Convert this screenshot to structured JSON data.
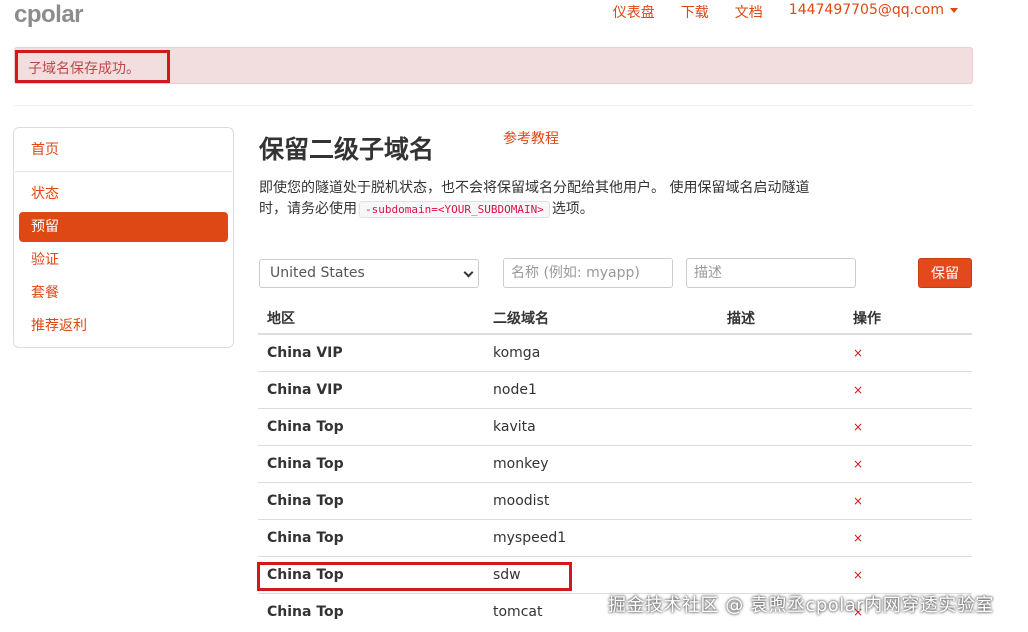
{
  "header": {
    "logo": "cpolar",
    "nav": [
      "仪表盘",
      "下载",
      "文档"
    ],
    "user_email": "1447497705@qq.com"
  },
  "alert": {
    "message": "子域名保存成功。"
  },
  "sidebar": {
    "items": [
      {
        "label": "首页",
        "active": false
      },
      {
        "label": "状态",
        "active": false
      },
      {
        "label": "预留",
        "active": true
      },
      {
        "label": "验证",
        "active": false
      },
      {
        "label": "套餐",
        "active": false
      },
      {
        "label": "推荐返利",
        "active": false
      }
    ]
  },
  "main": {
    "title": "保留二级子域名",
    "ref_link": "参考教程",
    "desc_part1": "即使您的隧道处于脱机状态，也不会将保留域名分配给其他用户。 使用保留域名启动隧道时，请务必使用",
    "desc_code": "-subdomain=<YOUR_SUBDOMAIN>",
    "desc_part2": "选项。"
  },
  "form": {
    "region_selected": "United States",
    "name_placeholder": "名称 (例如: myapp)",
    "desc_placeholder": "描述",
    "save_label": "保留"
  },
  "table": {
    "headers": [
      "地区",
      "二级域名",
      "描述",
      "操作"
    ],
    "delete_glyph": "×",
    "rows": [
      {
        "region": "China VIP",
        "subdomain": "komga",
        "desc": ""
      },
      {
        "region": "China VIP",
        "subdomain": "node1",
        "desc": ""
      },
      {
        "region": "China Top",
        "subdomain": "kavita",
        "desc": ""
      },
      {
        "region": "China Top",
        "subdomain": "monkey",
        "desc": ""
      },
      {
        "region": "China Top",
        "subdomain": "moodist",
        "desc": ""
      },
      {
        "region": "China Top",
        "subdomain": "myspeed1",
        "desc": ""
      },
      {
        "region": "China Top",
        "subdomain": "sdw",
        "desc": ""
      },
      {
        "region": "China Top",
        "subdomain": "tomcat",
        "desc": ""
      }
    ]
  },
  "watermark": "掘金技术社区 @ 袁煦丞cpolar内网穿透实验室"
}
